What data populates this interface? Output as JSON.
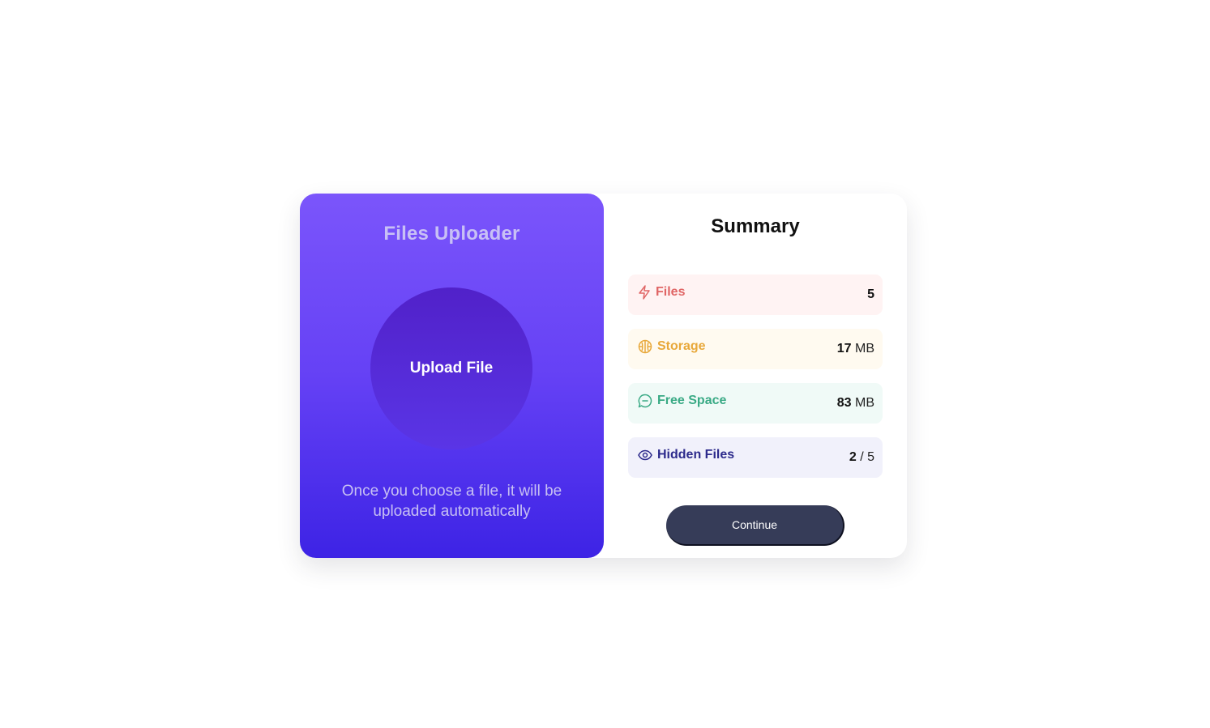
{
  "uploader": {
    "title": "Files Uploader",
    "upload_label": "Upload File",
    "note": "Once you choose a file, it will be uploaded automatically"
  },
  "summary": {
    "title": "Summary",
    "items": [
      {
        "label": "Files",
        "value": "5",
        "unit": "",
        "icon": "lightning-icon",
        "color": "#e06565"
      },
      {
        "label": "Storage",
        "value": "17",
        "unit": "MB",
        "icon": "brain-icon",
        "color": "#e8a83a"
      },
      {
        "label": "Free Space",
        "value": "83",
        "unit": "MB",
        "icon": "chat-bubble-icon",
        "color": "#3aaa85"
      },
      {
        "label": "Hidden Files",
        "value": "2",
        "unit": "/ 5",
        "icon": "eye-icon",
        "color": "#2d2b8c"
      }
    ],
    "continue_label": "Continue"
  }
}
